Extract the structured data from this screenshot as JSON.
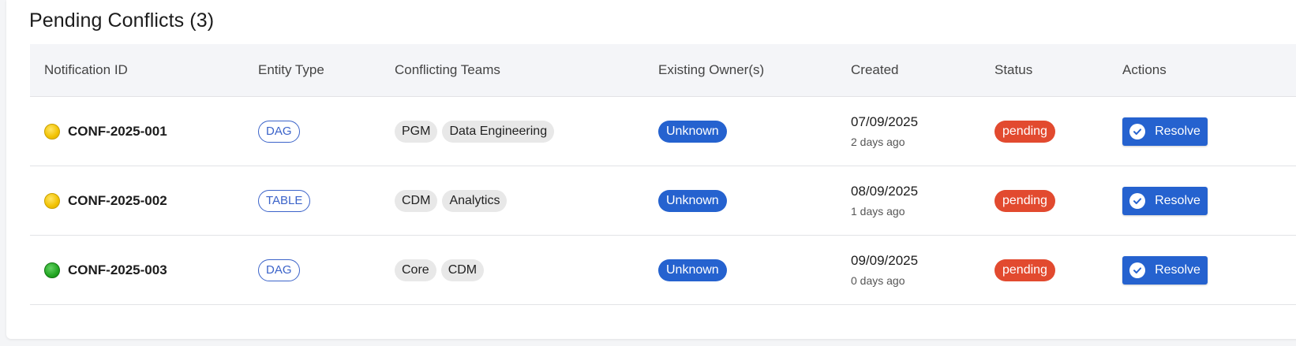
{
  "section": {
    "title": "Pending Conflicts (3)"
  },
  "table": {
    "headers": [
      "Notification ID",
      "Entity Type",
      "Conflicting Teams",
      "Existing Owner(s)",
      "Created",
      "Status",
      "Actions"
    ],
    "rows": [
      {
        "indicator": "yellow",
        "id": "CONF-2025-001",
        "entity_type": "DAG",
        "teams": [
          "PGM",
          "Data Engineering"
        ],
        "owner": "Unknown",
        "created_date": "07/09/2025",
        "created_ago": "2 days ago",
        "status": "pending",
        "action": "Resolve"
      },
      {
        "indicator": "yellow",
        "id": "CONF-2025-002",
        "entity_type": "TABLE",
        "teams": [
          "CDM",
          "Analytics"
        ],
        "owner": "Unknown",
        "created_date": "08/09/2025",
        "created_ago": "1 days ago",
        "status": "pending",
        "action": "Resolve"
      },
      {
        "indicator": "green",
        "id": "CONF-2025-003",
        "entity_type": "DAG",
        "teams": [
          "Core",
          "CDM"
        ],
        "owner": "Unknown",
        "created_date": "09/09/2025",
        "created_ago": "0 days ago",
        "status": "pending",
        "action": "Resolve"
      }
    ]
  },
  "colors": {
    "primary": "#2562cf",
    "status_pending": "#e24a2f",
    "indicator_yellow": "#f2c200",
    "indicator_green": "#22a622"
  },
  "icons": {
    "resolve": "check-circle-icon"
  }
}
